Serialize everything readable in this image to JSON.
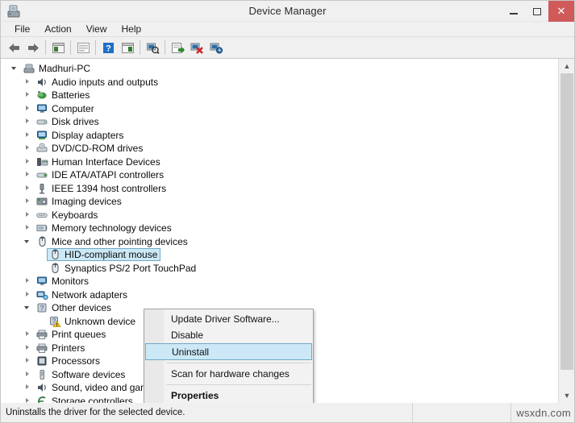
{
  "window": {
    "title": "Device Manager",
    "icon": "device-manager-icon",
    "controls": {
      "minimize": "minimize-button",
      "maximize": "maximize-button",
      "close_label": "✕"
    }
  },
  "menubar": {
    "items": [
      {
        "label": "File"
      },
      {
        "label": "Action"
      },
      {
        "label": "View"
      },
      {
        "label": "Help"
      }
    ]
  },
  "toolbar": {
    "buttons": [
      {
        "name": "back-icon"
      },
      {
        "name": "forward-icon"
      },
      {
        "name": "show-hide-console-tree-icon"
      },
      {
        "name": "properties-icon"
      },
      {
        "name": "help-icon"
      },
      {
        "name": "view-icon"
      },
      {
        "name": "scan-for-hardware-changes-icon"
      },
      {
        "name": "update-driver-software-icon"
      },
      {
        "name": "uninstall-device-icon"
      },
      {
        "name": "disable-device-icon"
      }
    ]
  },
  "tree": {
    "items": [
      {
        "label": "Madhuri-PC",
        "indent": 0,
        "state": "expanded",
        "icon": "computer-icon"
      },
      {
        "label": "Audio inputs and outputs",
        "indent": 1,
        "state": "collapsed",
        "icon": "speaker-icon"
      },
      {
        "label": "Batteries",
        "indent": 1,
        "state": "collapsed",
        "icon": "battery-icon"
      },
      {
        "label": "Computer",
        "indent": 1,
        "state": "collapsed",
        "icon": "monitor-icon"
      },
      {
        "label": "Disk drives",
        "indent": 1,
        "state": "collapsed",
        "icon": "disk-drive-icon"
      },
      {
        "label": "Display adapters",
        "indent": 1,
        "state": "collapsed",
        "icon": "display-adapter-icon"
      },
      {
        "label": "DVD/CD-ROM drives",
        "indent": 1,
        "state": "collapsed",
        "icon": "optical-drive-icon"
      },
      {
        "label": "Human Interface Devices",
        "indent": 1,
        "state": "collapsed",
        "icon": "hid-icon"
      },
      {
        "label": "IDE ATA/ATAPI controllers",
        "indent": 1,
        "state": "collapsed",
        "icon": "ide-controller-icon"
      },
      {
        "label": "IEEE 1394 host controllers",
        "indent": 1,
        "state": "collapsed",
        "icon": "firewire-icon"
      },
      {
        "label": "Imaging devices",
        "indent": 1,
        "state": "collapsed",
        "icon": "camera-icon"
      },
      {
        "label": "Keyboards",
        "indent": 1,
        "state": "collapsed",
        "icon": "keyboard-icon"
      },
      {
        "label": "Memory technology devices",
        "indent": 1,
        "state": "collapsed",
        "icon": "memory-icon"
      },
      {
        "label": "Mice and other pointing devices",
        "indent": 1,
        "state": "expanded",
        "icon": "mouse-icon"
      },
      {
        "label": "HID-compliant mouse",
        "indent": 2,
        "state": "leaf",
        "icon": "mouse-icon",
        "selected": true
      },
      {
        "label": "Synaptics PS/2 Port TouchPad",
        "indent": 2,
        "state": "leaf",
        "icon": "mouse-icon"
      },
      {
        "label": "Monitors",
        "indent": 1,
        "state": "collapsed",
        "icon": "monitor-icon"
      },
      {
        "label": "Network adapters",
        "indent": 1,
        "state": "collapsed",
        "icon": "network-adapter-icon"
      },
      {
        "label": "Other devices",
        "indent": 1,
        "state": "expanded",
        "icon": "unknown-device-icon"
      },
      {
        "label": "Unknown device",
        "indent": 2,
        "state": "leaf",
        "icon": "unknown-device-warning-icon"
      },
      {
        "label": "Print queues",
        "indent": 1,
        "state": "collapsed",
        "icon": "printer-icon"
      },
      {
        "label": "Printers",
        "indent": 1,
        "state": "collapsed",
        "icon": "printer-icon"
      },
      {
        "label": "Processors",
        "indent": 1,
        "state": "collapsed",
        "icon": "processor-icon"
      },
      {
        "label": "Software devices",
        "indent": 1,
        "state": "collapsed",
        "icon": "software-device-icon"
      },
      {
        "label": "Sound, video and game controllers",
        "indent": 1,
        "state": "collapsed",
        "icon": "speaker-icon"
      },
      {
        "label": "Storage controllers",
        "indent": 1,
        "state": "collapsed",
        "icon": "storage-controller-icon"
      }
    ]
  },
  "context_menu": {
    "items": [
      {
        "label": "Update Driver Software...",
        "type": "item"
      },
      {
        "label": "Disable",
        "type": "item"
      },
      {
        "label": "Uninstall",
        "type": "item",
        "selected": true
      },
      {
        "type": "separator"
      },
      {
        "label": "Scan for hardware changes",
        "type": "item"
      },
      {
        "type": "separator"
      },
      {
        "label": "Properties",
        "type": "item",
        "bold": true
      }
    ]
  },
  "statusbar": {
    "message": "Uninstalls the driver for the selected device.",
    "pane2": "",
    "watermark": "wsxdn.com"
  },
  "colors": {
    "selection_fill": "#cce8f6",
    "selection_border": "#6fa8c8",
    "close_button": "#d05a5a",
    "chrome": "#f0f0f0"
  }
}
